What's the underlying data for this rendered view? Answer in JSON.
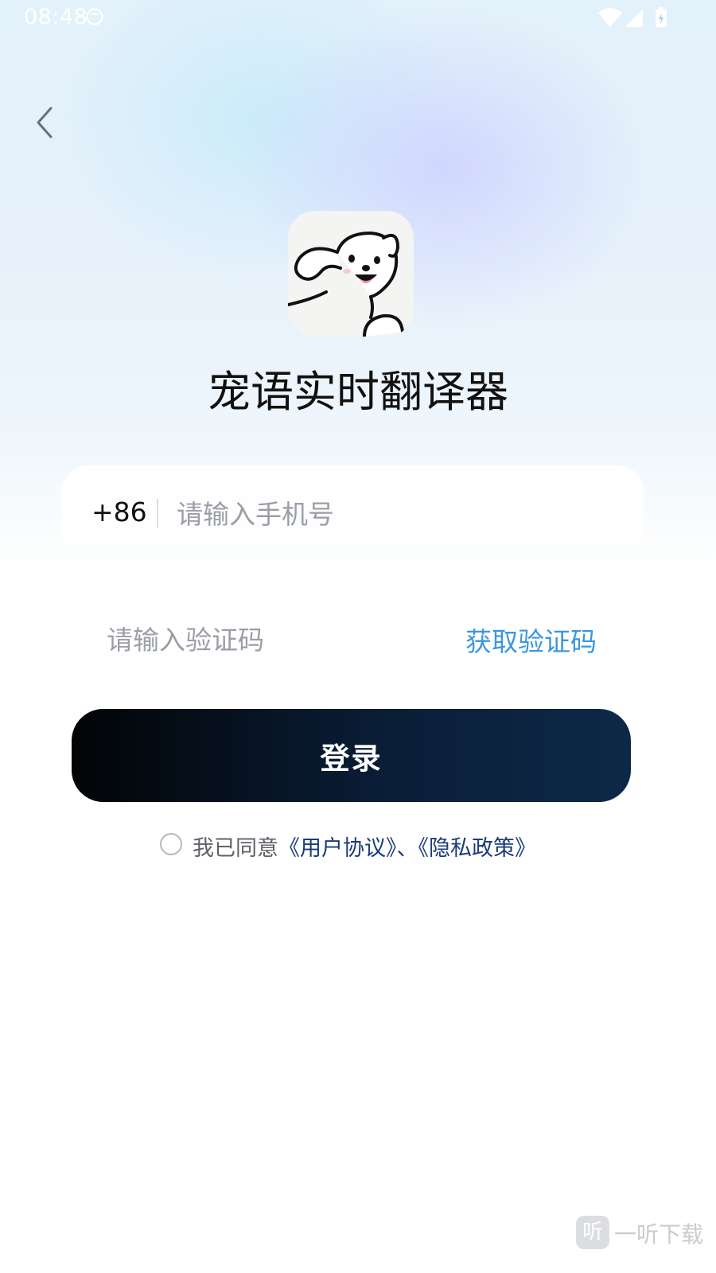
{
  "status_bar": {
    "time": "08:48"
  },
  "app": {
    "title": "宠语实时翻译器"
  },
  "form": {
    "country_code": "+86",
    "phone_placeholder": "请输入手机号",
    "code_placeholder": "请输入验证码",
    "get_code_label": "获取验证码",
    "login_label": "登录"
  },
  "agreement": {
    "prefix": "我已同意",
    "user_agreement": "《用户协议》",
    "separator": "、",
    "privacy_policy": "《隐私政策》",
    "checked": false
  },
  "watermark": {
    "icon_text": "听",
    "text": "一听下载"
  },
  "colors": {
    "accent_link": "#3b97dc",
    "policy_link": "#1a3c78",
    "button_start": "#020406",
    "button_end": "#0d2948"
  },
  "icons": {
    "back": "chevron-left-icon",
    "wifi": "wifi-icon",
    "signal": "signal-icon",
    "battery": "battery-icon"
  }
}
